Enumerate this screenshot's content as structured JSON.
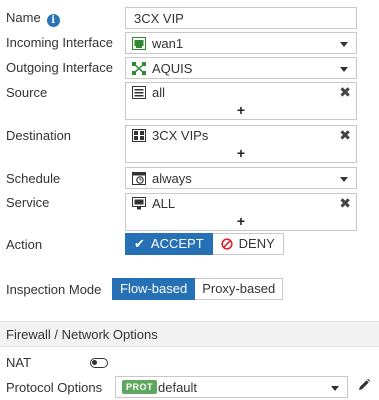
{
  "form": {
    "name": {
      "label": "Name",
      "value": "3CX VIP"
    },
    "incoming_interface": {
      "label": "Incoming Interface",
      "value": "wan1"
    },
    "outgoing_interface": {
      "label": "Outgoing Interface",
      "value": "AQUIS"
    },
    "source": {
      "label": "Source",
      "value": "all",
      "add": "+"
    },
    "destination": {
      "label": "Destination",
      "value": "3CX VIPs",
      "add": "+"
    },
    "schedule": {
      "label": "Schedule",
      "value": "always"
    },
    "service": {
      "label": "Service",
      "value": "ALL",
      "add": "+"
    },
    "action": {
      "label": "Action",
      "accept": "ACCEPT",
      "deny": "DENY",
      "selected": "ACCEPT"
    },
    "inspection_mode": {
      "label": "Inspection Mode",
      "flow": "Flow-based",
      "proxy": "Proxy-based",
      "selected": "Flow-based"
    }
  },
  "section": {
    "title": "Firewall / Network Options"
  },
  "nat": {
    "label": "NAT",
    "enabled": false
  },
  "protocol_options": {
    "label": "Protocol Options",
    "badge": "PROT",
    "value": "default"
  },
  "icons": {
    "info": "info-icon",
    "remove": "close-icon",
    "edit": "pencil-icon"
  },
  "colors": {
    "accent": "#2670b6",
    "info": "#2b73b7",
    "prot_badge": "#5fa75f",
    "deny": "#d9242b"
  }
}
